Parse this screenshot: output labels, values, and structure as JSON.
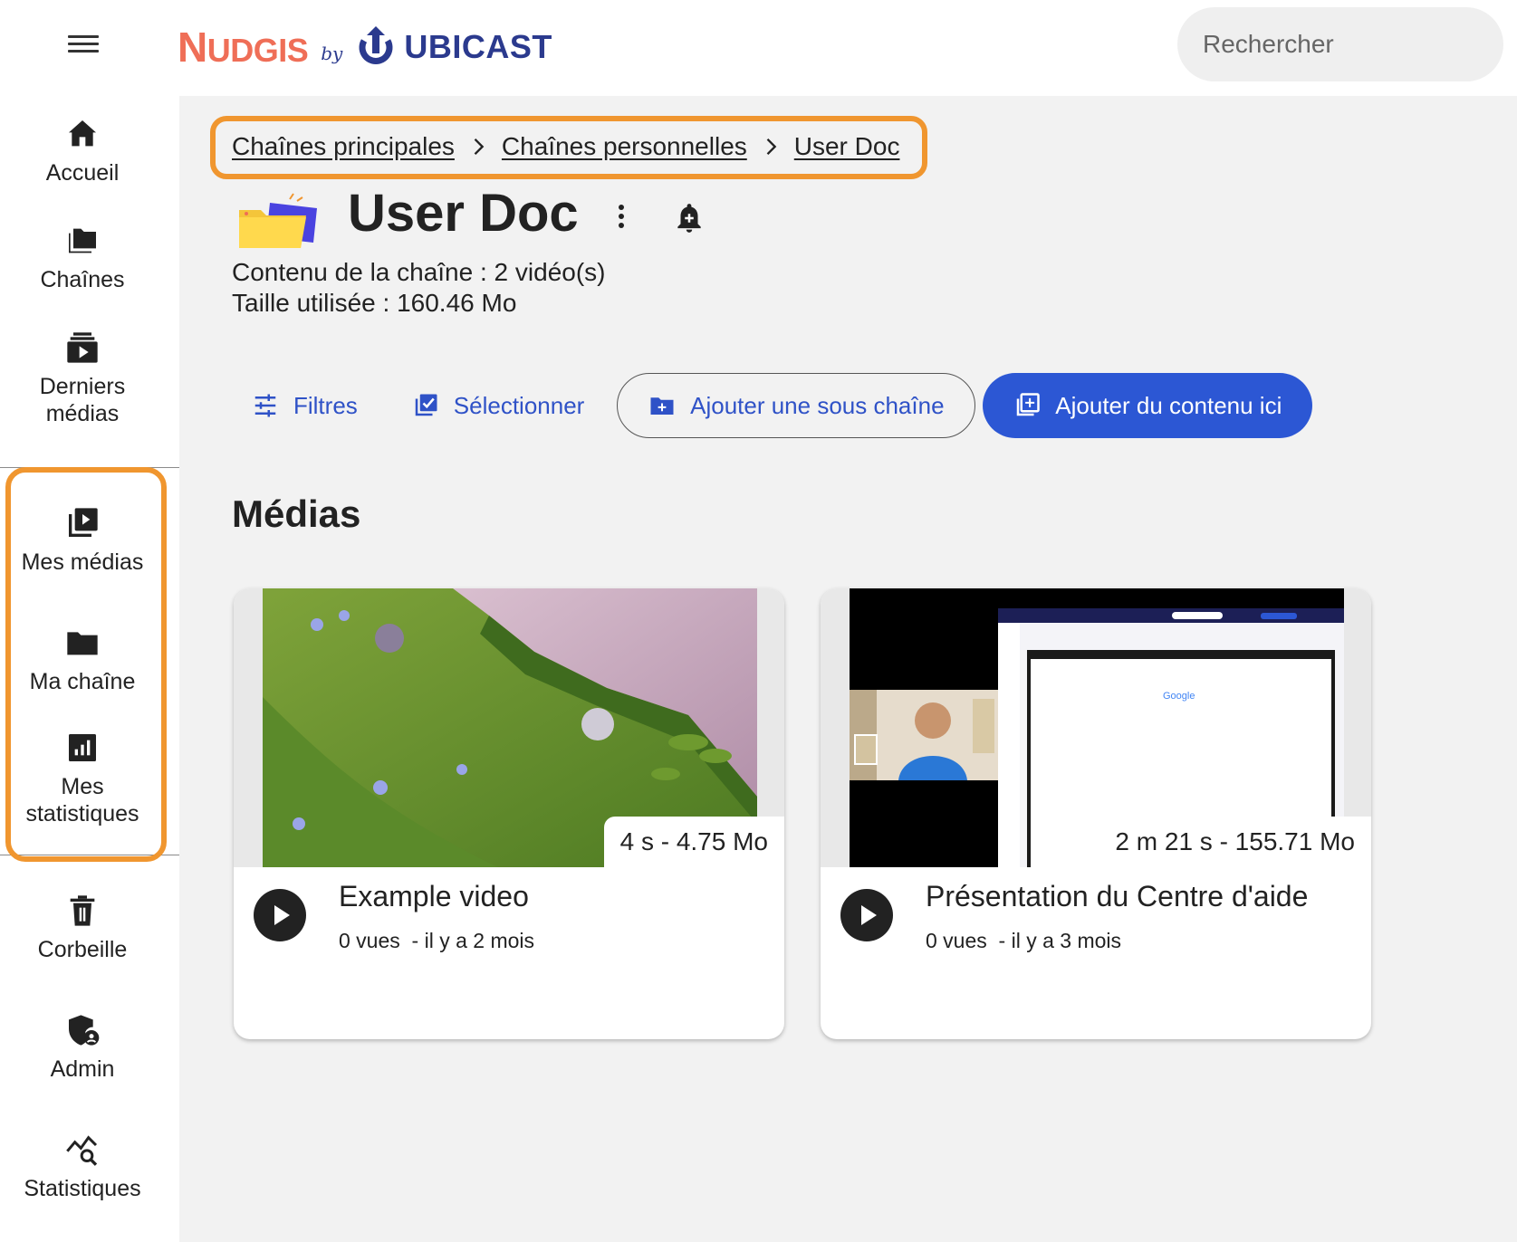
{
  "header": {
    "logo_nudgis_big": "N",
    "logo_nudgis_rest": "UDGIS",
    "logo_by": "by",
    "logo_ubicast": "UBICAST",
    "search_placeholder": "Rechercher"
  },
  "sidebar": {
    "items": [
      {
        "label": "Accueil",
        "icon": "home-icon"
      },
      {
        "label": "Chaînes",
        "icon": "folders-icon"
      },
      {
        "label": "Derniers médias",
        "icon": "latest-media-icon"
      },
      {
        "label": "Mes médias",
        "icon": "my-media-icon"
      },
      {
        "label": "Ma chaîne",
        "icon": "folder-icon"
      },
      {
        "label": "Mes statistiques",
        "icon": "bar-chart-icon"
      },
      {
        "label": "Corbeille",
        "icon": "trash-icon"
      },
      {
        "label": "Admin",
        "icon": "admin-shield-icon"
      },
      {
        "label": "Statistiques",
        "icon": "stats-search-icon"
      }
    ]
  },
  "breadcrumb": [
    "Chaînes principales",
    "Chaînes personnelles",
    "User Doc"
  ],
  "channel": {
    "title": "User Doc",
    "content_line": "Contenu de la chaîne : 2 vidéo(s)",
    "size_line": "Taille utilisée : 160.46 Mo"
  },
  "toolbar": {
    "filters": "Filtres",
    "select": "Sélectionner",
    "add_subchannel": "Ajouter une sous chaîne",
    "add_content": "Ajouter du contenu ici"
  },
  "section_title": "Médias",
  "media": [
    {
      "title": "Example video",
      "badge": "4 s - 4.75 Mo",
      "views": "0 vues",
      "age": "- il y a 2 mois"
    },
    {
      "title": "Présentation du Centre d'aide",
      "badge": "2 m 21 s - 155.71 Mo",
      "views": "0 vues",
      "age": "- il y a 3 mois"
    }
  ],
  "colors": {
    "accent": "#2c57d4",
    "highlight": "#f0962f",
    "brand_orange": "#ef6e57",
    "brand_blue": "#2b3a8e"
  }
}
